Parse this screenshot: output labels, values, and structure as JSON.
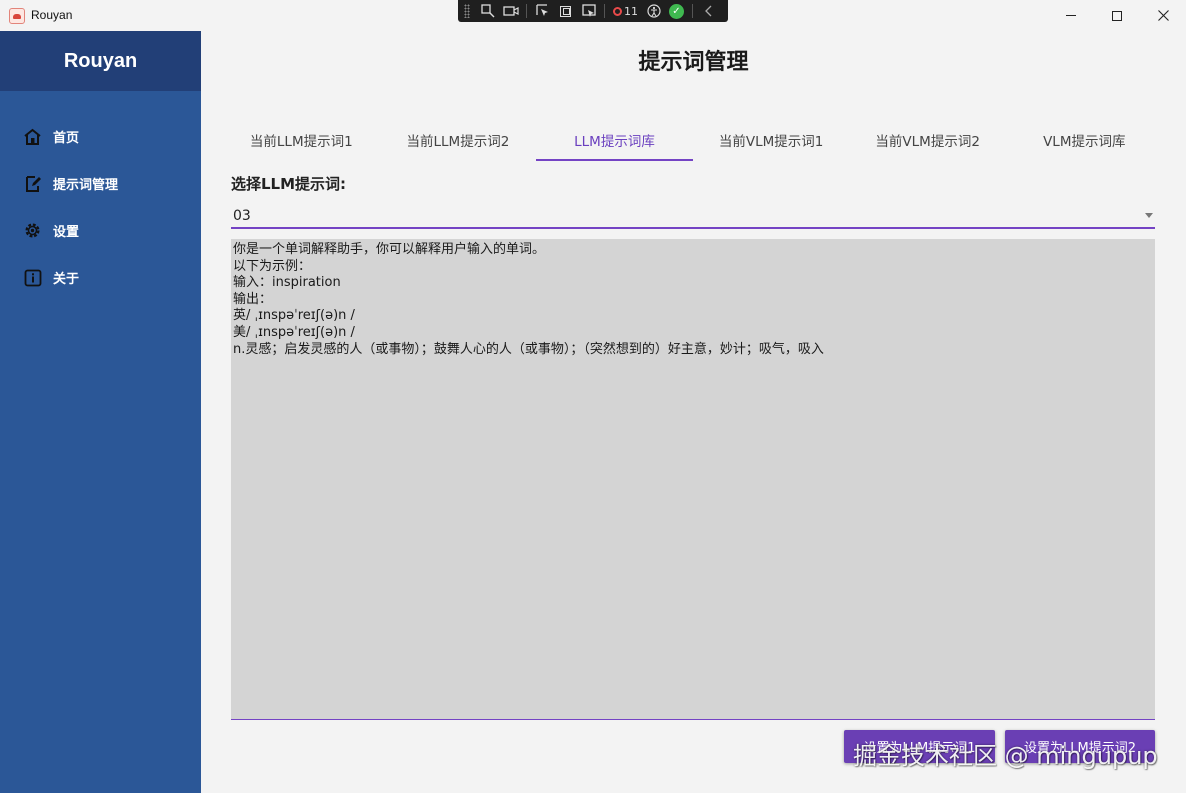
{
  "window": {
    "title": "Rouyan",
    "controls": {
      "minimize": "minimize-icon",
      "maximize": "maximize-icon",
      "close": "close-icon"
    }
  },
  "devtoolbar": {
    "frame_count": "11"
  },
  "sidebar": {
    "brand": "Rouyan",
    "items": [
      {
        "label": "首页",
        "icon": "home-icon"
      },
      {
        "label": "提示词管理",
        "icon": "edit-icon"
      },
      {
        "label": "设置",
        "icon": "gear-icon"
      },
      {
        "label": "关于",
        "icon": "info-icon"
      }
    ]
  },
  "main": {
    "title": "提示词管理",
    "tabs": [
      {
        "label": "当前LLM提示词1",
        "active": false
      },
      {
        "label": "当前LLM提示词2",
        "active": false
      },
      {
        "label": "LLM提示词库",
        "active": true
      },
      {
        "label": "当前VLM提示词1",
        "active": false
      },
      {
        "label": "当前VLM提示词2",
        "active": false
      },
      {
        "label": "VLM提示词库",
        "active": false
      }
    ],
    "select_label": "选择LLM提示词:",
    "select_value": "03",
    "prompt_text": "你是一个单词解释助手，你可以解释用户输入的单词。\n以下为示例：\n输入：inspiration\n输出：\n英/ ˌɪnspəˈreɪʃ(ə)n /\n美/ ˌɪnspəˈreɪʃ(ə)n /\nn.灵感；启发灵感的人（或事物）；鼓舞人心的人（或事物）；（突然想到的）好主意，妙计；吸气，吸入",
    "button1_label": "设置为LLM提示词1",
    "button2_label": "设置为LLM提示词2"
  },
  "watermark": "掘金技术社区 @ mingupup",
  "colors": {
    "sidebar": "#2b5797",
    "brand_bg": "#223f77",
    "accent": "#7443c4",
    "button": "#6a3fb4",
    "editor_bg": "#d4d4d4"
  }
}
